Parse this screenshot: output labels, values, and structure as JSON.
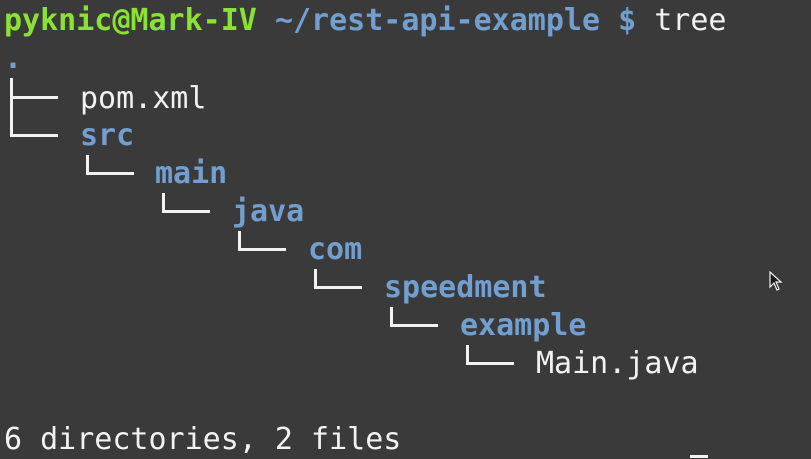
{
  "prompt": {
    "user_host": "pyknic@Mark-IV",
    "path": "~/rest-api-example",
    "symbol": "$",
    "command": "tree"
  },
  "tree": {
    "root": ".",
    "entries": [
      {
        "name": "pom.xml",
        "type": "file",
        "depth": 0
      },
      {
        "name": "src",
        "type": "dir",
        "depth": 0
      },
      {
        "name": "main",
        "type": "dir",
        "depth": 1
      },
      {
        "name": "java",
        "type": "dir",
        "depth": 2
      },
      {
        "name": "com",
        "type": "dir",
        "depth": 3
      },
      {
        "name": "speedment",
        "type": "dir",
        "depth": 4
      },
      {
        "name": "example",
        "type": "dir",
        "depth": 5
      },
      {
        "name": "Main.java",
        "type": "file",
        "depth": 6
      }
    ]
  },
  "summary": "6 directories, 2 files",
  "colors": {
    "background": "#3a3a3a",
    "user_host": "#8ae234",
    "directory": "#729fcf",
    "text": "#f2f2f2"
  }
}
